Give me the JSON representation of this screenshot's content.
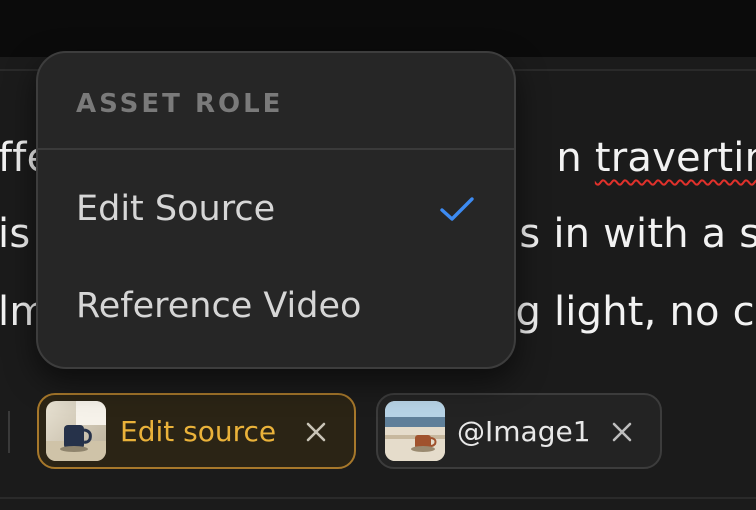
{
  "prompt": {
    "line1_before": "ffe",
    "line1_middle_hidden": "",
    "line1_end_prefix": "n ",
    "line1_misspelled": "travertine",
    "line2_start": "is",
    "line2_end": "s in with a s",
    "line3_start": "lm",
    "line3_end": "g light, no c"
  },
  "menu": {
    "title": "ASSET ROLE",
    "items": [
      {
        "label": "Edit Source",
        "selected": true
      },
      {
        "label": "Reference Video",
        "selected": false
      }
    ]
  },
  "chips": [
    {
      "label": "Edit source",
      "thumbnail": "mug-on-windowsill-photo",
      "accent": "#eab23a"
    },
    {
      "label": "@Image1",
      "thumbnail": "seaside-cup-photo",
      "accent": "#e8e8e8"
    }
  ],
  "icons": {
    "check": "checkmark-icon",
    "close": "close-icon"
  },
  "colors": {
    "accent_check": "#3d8bf2",
    "spellcheck": "#e0312b",
    "chip_selected_border": "#a7782b"
  }
}
